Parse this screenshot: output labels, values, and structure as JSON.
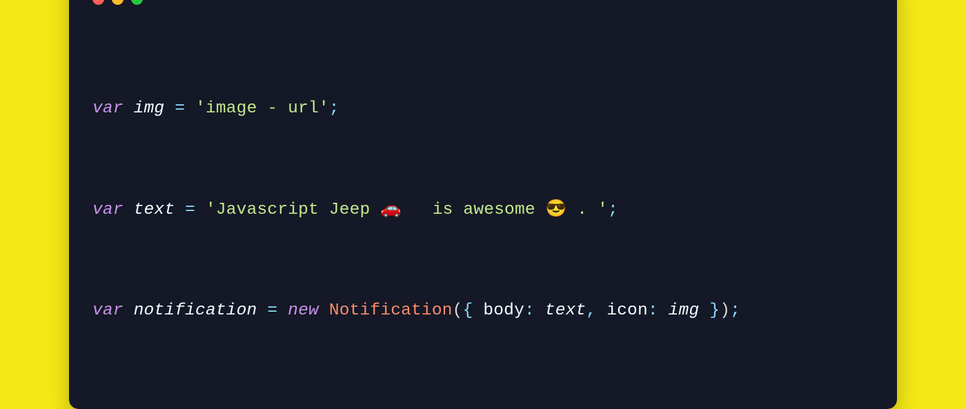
{
  "code": {
    "line1": {
      "t1": "var",
      "t2": " ",
      "t3": "img",
      "t4": " ",
      "t5": "=",
      "t6": " ",
      "t7": "'image - url'",
      "t8": ";"
    },
    "line2": {
      "t1": "var",
      "t2": " ",
      "t3": "text",
      "t4": " ",
      "t5": "=",
      "t6": " ",
      "t7": "'Javascript Jeep 🚗   is awesome 😎 . '",
      "t8": ";"
    },
    "line3": {
      "t1": "var",
      "t2": " ",
      "t3": "notification",
      "t4": " ",
      "t5": "=",
      "t6": " ",
      "t7": "new",
      "t8": " ",
      "t9": "Notification",
      "t10": "(",
      "t11": "{",
      "t12": " body",
      "t13": ":",
      "t14": " ",
      "t15": "text",
      "t16": ",",
      "t17": " icon",
      "t18": ":",
      "t19": " ",
      "t20": "img",
      "t21": " ",
      "t22": "}",
      "t23": ")",
      "t24": ";"
    }
  }
}
